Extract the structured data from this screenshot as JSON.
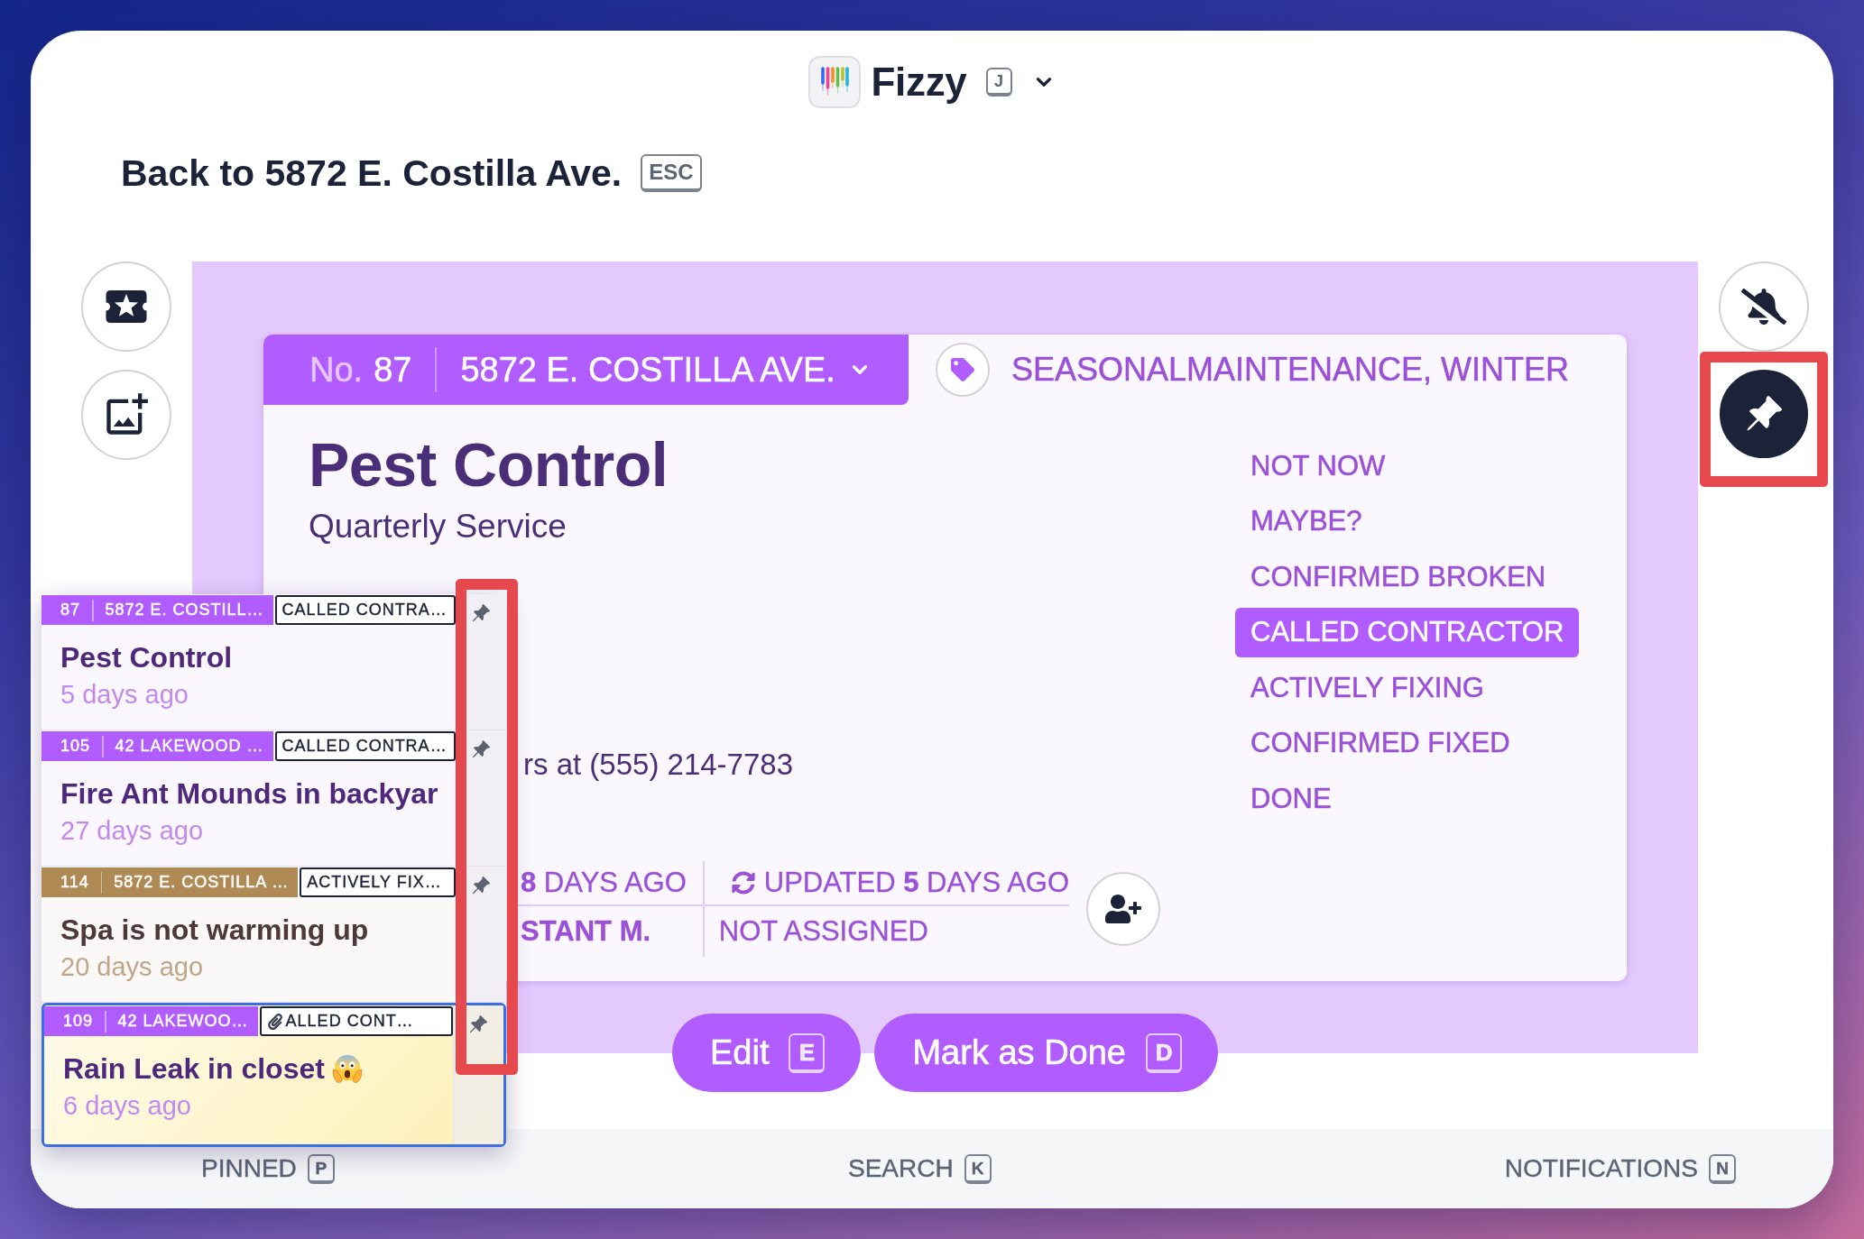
{
  "app": {
    "name": "Fizzy",
    "shortcut": "J"
  },
  "back_link": {
    "label": "Back to 5872 E. Costilla Ave.",
    "shortcut": "ESC"
  },
  "notifications": {
    "muted": true
  },
  "pin_button": {
    "on": true,
    "highlighted": true
  },
  "card": {
    "number_label": "No.",
    "number": "87",
    "location": "5872 E. COSTILLA AVE.",
    "tags": "SEASONALMAINTENANCE, WINTER",
    "title": "Pest Control",
    "subtitle": "Quarterly Service",
    "description": "rs at (555) 214-7783",
    "meta": {
      "created": "**8** DAYS AGO",
      "updated": "UPDATED **5** DAYS AGO",
      "creator": "STANT M.",
      "assignee": "NOT ASSIGNED"
    },
    "statuses": [
      {
        "label": "NOT NOW",
        "selected": false
      },
      {
        "label": "MAYBE?",
        "selected": false
      },
      {
        "label": "CONFIRMED BROKEN",
        "selected": false
      },
      {
        "label": "CALLED CONTRACTOR",
        "selected": true
      },
      {
        "label": "ACTIVELY FIXING",
        "selected": false
      },
      {
        "label": "CONFIRMED FIXED",
        "selected": false
      },
      {
        "label": "DONE",
        "selected": false
      }
    ]
  },
  "actions": [
    {
      "label": "Edit",
      "shortcut": "E"
    },
    {
      "label": "Mark as Done",
      "shortcut": "D"
    }
  ],
  "pinned": {
    "pin_column_highlighted": true,
    "items": [
      {
        "number": "87",
        "location": "5872 E. COSTILL…",
        "status": "CALLED CONTRA…",
        "title": "Pest Control",
        "age": "5 days ago",
        "color": "#b15cff",
        "selected": false,
        "attachment": false,
        "emoji": false
      },
      {
        "number": "105",
        "location": "42 LAKEWOOD …",
        "status": "CALLED CONTRA…",
        "title": "Fire Ant Mounds in backyar",
        "age": "27 days ago",
        "color": "#b15cff",
        "selected": false,
        "attachment": false,
        "emoji": false
      },
      {
        "number": "114",
        "location": "5872 E. COSTILLA …",
        "status": "ACTIVELY FIX…",
        "title": "Spa is not warming up",
        "age": "20 days ago",
        "color": "#b08a55",
        "selected": false,
        "attachment": false,
        "emoji": false
      },
      {
        "number": "109",
        "location": "42 LAKEWOO…",
        "status": "ALLED CONT…",
        "title": "Rain Leak in closet",
        "age": "6 days ago",
        "color": "#b15cff",
        "selected": true,
        "attachment": true,
        "emoji": true
      }
    ]
  },
  "footer": [
    {
      "label": "PINNED",
      "shortcut": "P"
    },
    {
      "label": "SEARCH",
      "shortcut": "K"
    },
    {
      "label": "NOTIFICATIONS",
      "shortcut": "N"
    }
  ]
}
